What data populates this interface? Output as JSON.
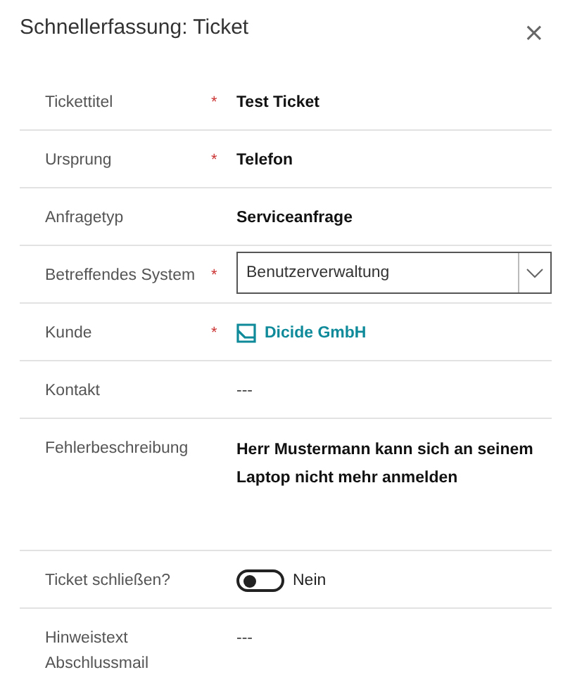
{
  "dialog": {
    "title": "Schnellerfassung: Ticket",
    "close": "×"
  },
  "fields": [
    {
      "kind": "text",
      "label": "Tickettitel",
      "required_mark": "*",
      "value": "Test Ticket"
    },
    {
      "kind": "text",
      "label": "Ursprung",
      "required_mark": "*",
      "value": "Telefon"
    },
    {
      "kind": "text",
      "label": "Anfragetyp",
      "value": "Serviceanfrage"
    },
    {
      "kind": "dropdown",
      "label": "Betreffendes System",
      "required_mark": "*",
      "value": "Benutzerverwaltung"
    },
    {
      "kind": "link",
      "label": "Kunde",
      "required_mark": "*",
      "value": "Dicide GmbH"
    },
    {
      "kind": "empty",
      "label": "Kontakt",
      "value": "---"
    },
    {
      "kind": "multiline",
      "label": "Fehlerbeschreibung",
      "value": "Herr Mustermann kann sich an seinem Laptop nicht mehr anmelden"
    },
    {
      "kind": "toggle",
      "label": "Ticket schließen?",
      "on": false,
      "value": "Nein"
    },
    {
      "kind": "empty",
      "label": "Hinweistext Abschlussmail",
      "value": "---"
    }
  ]
}
